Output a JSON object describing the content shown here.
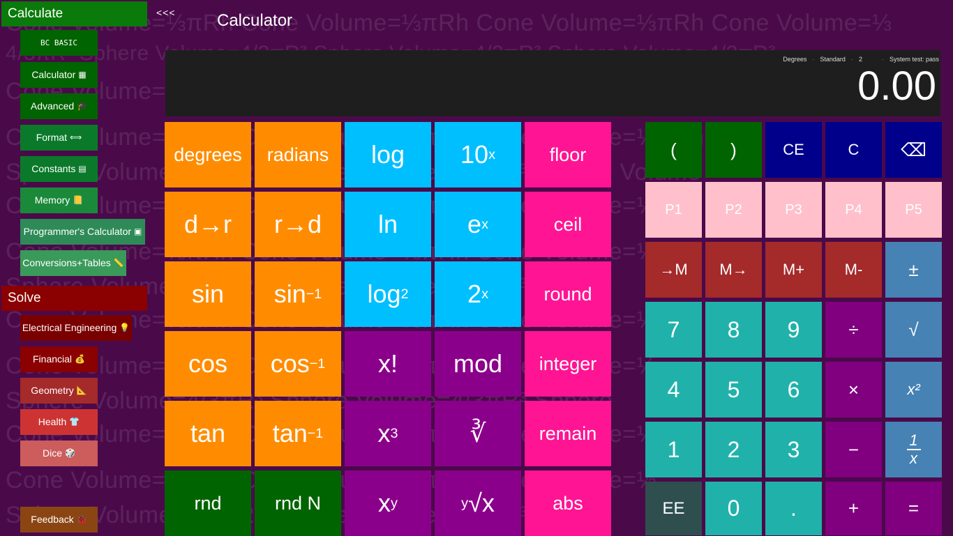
{
  "sidebar": {
    "calculate_header": "Calculate",
    "collapse_label": "<<<",
    "calc_items": [
      {
        "label": "BC BASIC",
        "icon": "",
        "color": "#006400"
      },
      {
        "label": "Calculator",
        "icon": "calculator-icon",
        "color": "#006400"
      },
      {
        "label": "Advanced",
        "icon": "graduation-cap-icon",
        "color": "#006400"
      },
      {
        "label": "Format",
        "icon": "left-right-arrow-icon",
        "color": "#0a7a2a"
      },
      {
        "label": "Constants",
        "icon": "table-icon",
        "color": "#0a7a2a"
      },
      {
        "label": "Memory",
        "icon": "notebook-icon",
        "color": "#1a8a3a"
      },
      {
        "label": "Programmer's Calculator",
        "icon": "chip-icon",
        "color": "#2e8b57"
      },
      {
        "label": "Conversions+Tables",
        "icon": "ruler-icon",
        "color": "#3a9a5a"
      }
    ],
    "solve_header": "Solve",
    "solve_items": [
      {
        "label": "Electrical Engineering",
        "icon": "lightbulb-icon",
        "color": "#7a0000"
      },
      {
        "label": "Financial",
        "icon": "money-bag-icon",
        "color": "#8b0000"
      },
      {
        "label": "Geometry",
        "icon": "triangle-ruler-icon",
        "color": "#a52a2a"
      },
      {
        "label": "Health",
        "icon": "shirt-icon",
        "color": "#cd3333"
      },
      {
        "label": "Dice",
        "icon": "dice-icon",
        "color": "#cd5c5c"
      }
    ],
    "feedback_label": "Feedback",
    "feedback_icon": "bug-icon"
  },
  "header": {
    "title": "Calculator"
  },
  "background_formulas": [
    "Cone Volume=⅓πRh   Cone Volume=⅓πRh   Cone Volume=⅓πRh   Cone Volume=⅓"
  ],
  "display": {
    "status": [
      "Degrees",
      "Standard",
      "2",
      "System test: pass"
    ],
    "value": "0.00"
  },
  "functions": {
    "degrees": "degrees",
    "radians": "radians",
    "log": "log",
    "ten_x": "10",
    "floor": "floor",
    "d_to_r": "d→r",
    "r_to_d": "r→d",
    "ln": "ln",
    "e_x": "e",
    "ceil": "ceil",
    "sin": "sin",
    "asin": "sin",
    "log2": "log",
    "two_x": "2",
    "round": "round",
    "cos": "cos",
    "acos": "cos",
    "fact": "x!",
    "mod": "mod",
    "integer": "integer",
    "tan": "tan",
    "atan": "tan",
    "cube": "x",
    "cbrt": "∛",
    "remain": "remain",
    "rnd": "rnd",
    "rnd_n": "rnd N",
    "pow": "x",
    "root": "√x",
    "abs": "abs",
    "exp_x": "x",
    "exp_y": "y",
    "exp_3": "3",
    "exp_neg1": "−1",
    "sub_2": "2"
  },
  "keypad": {
    "lparen": "(",
    "rparen": ")",
    "ce": "CE",
    "c": "C",
    "backspace": "⌫",
    "p1": "P1",
    "p2": "P2",
    "p3": "P3",
    "p4": "P4",
    "p5": "P5",
    "to_m": "→M",
    "m_to": "M→",
    "m_plus": "M+",
    "m_minus": "M-",
    "plus_minus": "±",
    "n7": "7",
    "n8": "8",
    "n9": "9",
    "divide": "÷",
    "sqrt": "√",
    "n4": "4",
    "n5": "5",
    "n6": "6",
    "times": "×",
    "square": "x²",
    "n1": "1",
    "n2": "2",
    "n3": "3",
    "minus": "−",
    "recip_num": "1",
    "recip_den": "x",
    "ee": "EE",
    "n0": "0",
    "dot": ".",
    "plus": "+",
    "equals": "="
  },
  "colors": {
    "background": "#4a0a4a",
    "orange": "#ff8c00",
    "cyan": "#00bfff",
    "pink": "#ff1493",
    "purple": "#8b008b",
    "green": "#006400",
    "teal": "#20b2aa",
    "navy": "#00008b"
  }
}
